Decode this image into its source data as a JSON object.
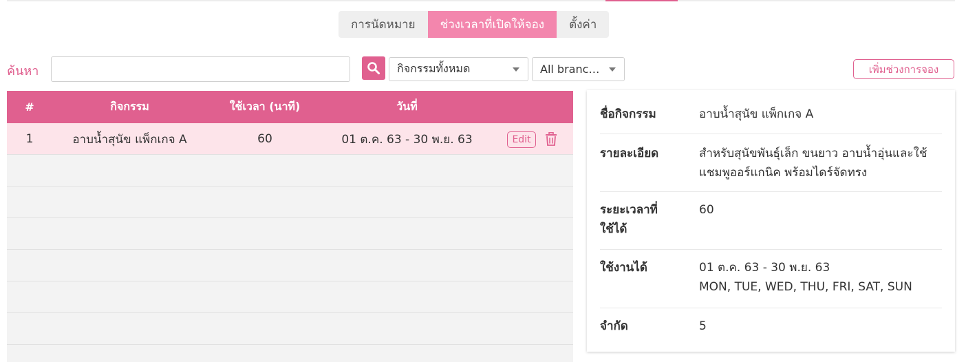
{
  "tabs": [
    {
      "label": "การนัดหมาย",
      "active": false
    },
    {
      "label": "ช่วงเวลาที่เปิดให้จอง",
      "active": true
    },
    {
      "label": "ตั้งค่า",
      "active": false
    }
  ],
  "search": {
    "label": "ค้นหา",
    "value": "",
    "placeholder": ""
  },
  "filters": {
    "activity": "กิจกรรมทั้งหมด",
    "branch": "All branc…"
  },
  "add_button": "เพิ่มช่วงการจอง",
  "table": {
    "headers": [
      "#",
      "กิจกรรม",
      "ใช้เวลา (นาที)",
      "วันที่"
    ],
    "rows": [
      {
        "num": "1",
        "activity": "อาบน้ำสุนัข แพ็กเกจ A",
        "duration": "60",
        "date": "01 ต.ค. 63 - 30 พ.ย. 63",
        "edit": "Edit"
      }
    ]
  },
  "detail": {
    "name_label": "ชื่อกิจกรรม",
    "name_value": "อาบน้ำสุนัข แพ็กเกจ A",
    "desc_label": "รายละเอียด",
    "desc_line1": "สำหรับสุนัขพันธุ์เล็ก ขนยาว อาบน้ำอุ่นและใช้",
    "desc_line2": "แชมพูออร์แกนิค พร้อมไดร์จัดทรง",
    "duration_label_1": "ระยะเวลาที่",
    "duration_label_2": "ใช้ได้",
    "duration_value": "60",
    "available_label": "ใช้งานได้",
    "available_dates": "01 ต.ค. 63 - 30 พ.ย. 63",
    "available_days": "MON, TUE, WED, THU, FRI, SAT, SUN",
    "limit_label": "จำกัด",
    "limit_value": "5"
  },
  "colors": {
    "accent": "#e0608f",
    "tab_active": "#f386ad",
    "row_selected": "#fde4ea"
  },
  "icons": {
    "search": "search-icon",
    "delete": "trash-icon"
  }
}
